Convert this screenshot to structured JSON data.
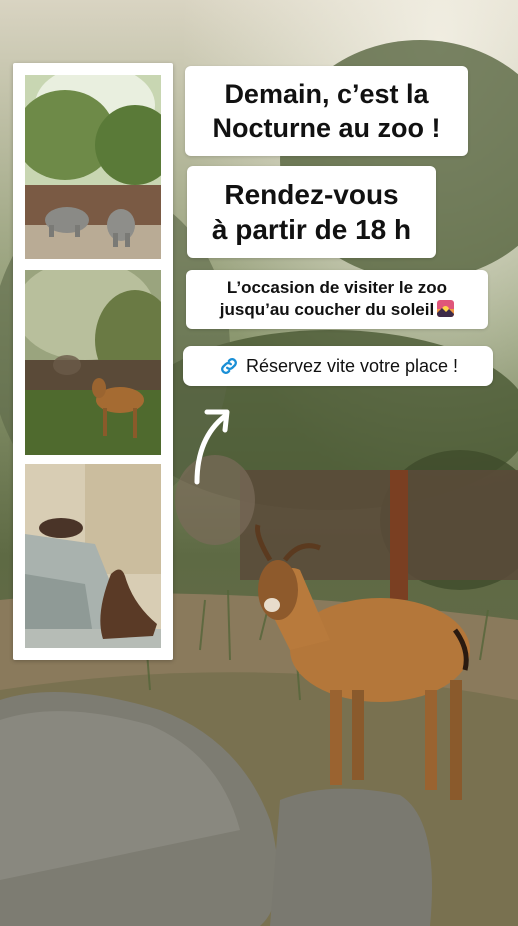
{
  "headline": {
    "line1": "Demain, c’est la",
    "line2": "Nocturne au zoo !"
  },
  "rendezvous": {
    "line1": "Rendez-vous",
    "line2": "à partir de 18 h"
  },
  "occasion": {
    "line1": "L’occasion de visiter le zoo",
    "line2": "jusqu’au coucher du soleil"
  },
  "reserve": {
    "label": "Réservez vite votre place !",
    "icon": "link-icon"
  },
  "photos": [
    {
      "subject": "rhinoceros"
    },
    {
      "subject": "antelope"
    },
    {
      "subject": "sea-lion"
    }
  ],
  "icons": {
    "sunset": "sunset-emoji-icon",
    "arrow": "curved-arrow-icon"
  },
  "colors": {
    "bubble": "#ffffff",
    "text": "#111111",
    "link_icon": "#1a8fd6"
  }
}
